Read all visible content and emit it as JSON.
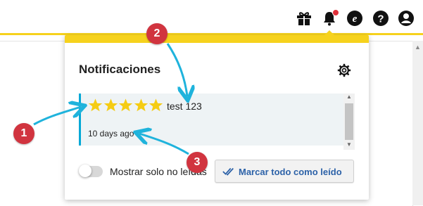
{
  "topbar": {
    "icons": [
      "gift-icon",
      "bell-icon",
      "edge-icon",
      "help-icon",
      "account-icon"
    ],
    "accent_color": "#f6d21d",
    "bell_dot_color": "#e0303a"
  },
  "notifications": {
    "title": "Notificaciones",
    "items": [
      {
        "rating": 5,
        "text": "test 123",
        "time": "10 days ago"
      }
    ],
    "toggle_label": "Mostrar solo no leídas",
    "toggle_on": false,
    "mark_all_label": "Marcar todo como leído",
    "accent_color": "#00a8d6",
    "star_color": "#f5cc14"
  },
  "annotations": {
    "badges": [
      "1",
      "2",
      "3"
    ],
    "color": "#d1343f",
    "arrow_color": "#1fb3dc"
  }
}
